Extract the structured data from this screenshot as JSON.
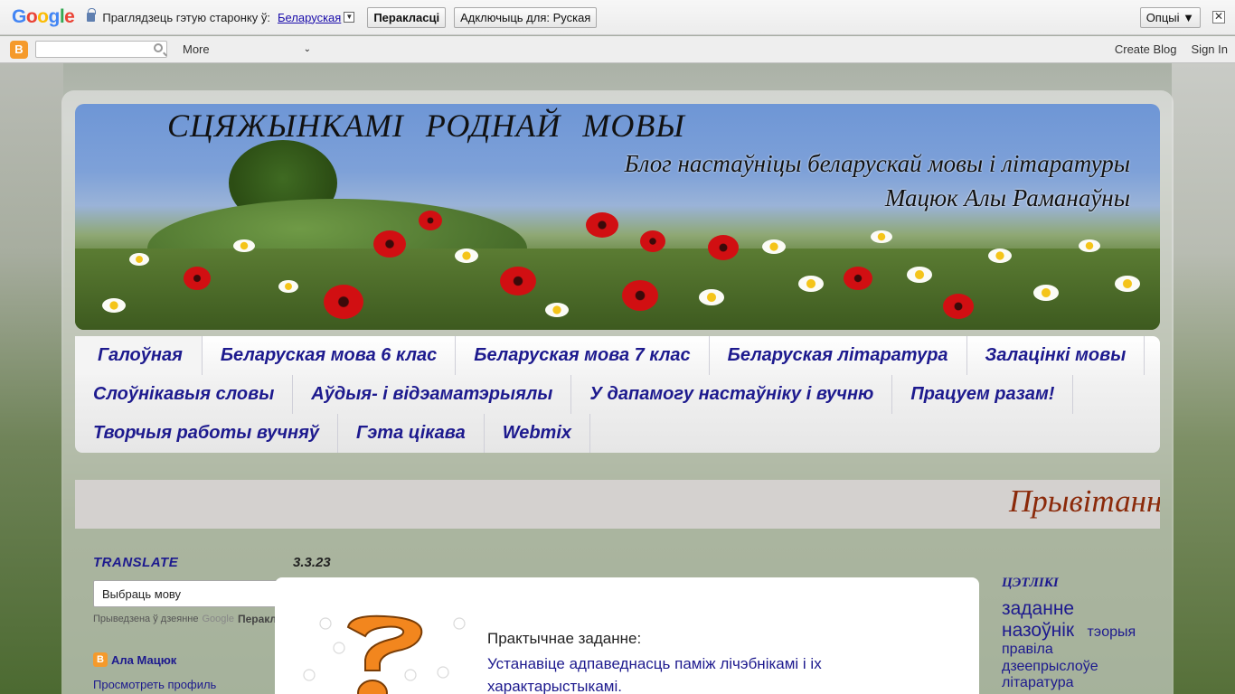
{
  "translate_bar": {
    "logo": "Google",
    "prompt": "Праглядзець гэтую старонку ў:",
    "language": "Беларуская",
    "translate_button": "Перакласці",
    "turn_off_button": "Адключыць для: Руская",
    "options_button": "Опцыі ▼",
    "close": "✕"
  },
  "navbar": {
    "more_label": "More",
    "create_blog": "Create Blog",
    "sign_in": "Sign In"
  },
  "header": {
    "title": "СЦЯЖЫНКАМІ РОДНАЙ МОВЫ",
    "subtitle_line1": "Блог настаўніцы беларускай мовы і літаратуры",
    "subtitle_line2": "Мацюк Алы Раманаўны"
  },
  "tabs": {
    "row1": [
      "Галоўная",
      "Беларуская мова 6 клас",
      "Беларуская мова 7 клас",
      "Беларуская літаратура",
      "Залацінкі мовы"
    ],
    "row2": [
      "Слоўнікавыя словы",
      "Аўдыя- і відэаматэрыялы",
      "У дапамогу настаўніку і вучню",
      "Працуем разам!"
    ],
    "row3": [
      "Творчыя работы вучняў",
      "Гэта цікава",
      "Webmix"
    ]
  },
  "marquee": {
    "text": "Прывітанн"
  },
  "sidebar_left": {
    "translate_title": "Translate",
    "select_value": "Выбраць мову",
    "powered_prefix": "Прыведзена ў дзеянне",
    "powered_google": "Google",
    "powered_product": "Перакладчык",
    "profile_name": "Ала Мацюк",
    "profile_link": "Просмотреть профиль"
  },
  "post": {
    "date": "3.3.23",
    "label": "Практычнае заданне:",
    "body": "Устанавіце адпаведнасць паміж лічэбнікамі і іх характарыстыкамі."
  },
  "sidebar_right": {
    "tags_title": "ЦЭТЛІКІ",
    "tags": [
      {
        "label": "заданне"
      },
      {
        "label": "назоўнік"
      },
      {
        "label": "тэорыя"
      },
      {
        "label": "правіла"
      },
      {
        "label": "дзеепрыслоўе"
      },
      {
        "label": "літаратура"
      }
    ]
  }
}
